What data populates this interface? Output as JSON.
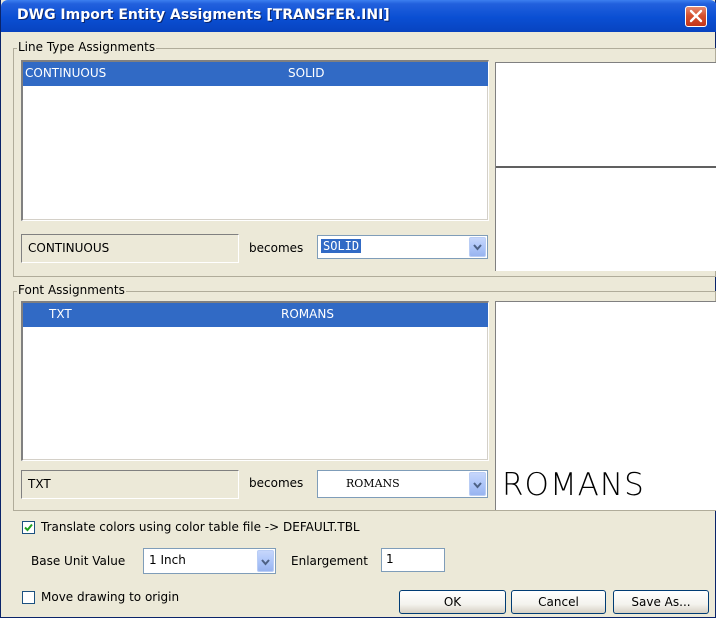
{
  "window": {
    "title": "DWG Import Entity Assigments [TRANSFER.INI]",
    "close_icon": "close-icon"
  },
  "linetype": {
    "group_label": "Line Type Assignments",
    "rows": [
      {
        "source": "CONTINUOUS",
        "target": "SOLID"
      }
    ],
    "selected_source": "CONTINUOUS",
    "becomes_label": "becomes",
    "combo_value": "SOLID"
  },
  "font": {
    "group_label": "Font Assignments",
    "rows": [
      {
        "source": "TXT",
        "target": "ROMANS"
      }
    ],
    "selected_source": "TXT",
    "becomes_label": "becomes",
    "combo_value": "ROMANS",
    "preview_text": "ROMANS"
  },
  "options": {
    "translate_checked": true,
    "translate_label": "Translate colors using color table file  -> DEFAULT.TBL",
    "base_unit_label": "Base Unit Value",
    "base_unit_value": "1 Inch",
    "enlargement_label": "Enlargement",
    "enlargement_value": "1",
    "move_origin_checked": false,
    "move_origin_label": "Move drawing to origin"
  },
  "buttons": {
    "ok": "OK",
    "cancel": "Cancel",
    "save_as": "Save As..."
  },
  "colors": {
    "selection": "#316ac5",
    "titlebar": "#0a4fd3",
    "dialog_bg": "#ece9d8"
  }
}
